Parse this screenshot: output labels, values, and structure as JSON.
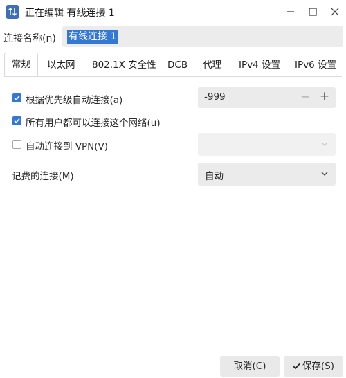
{
  "window": {
    "title": "正在编辑 有线连接 1"
  },
  "name_row": {
    "label": "连接名称(n)",
    "value": "有线连接 1"
  },
  "tabs": [
    {
      "label": "常规"
    },
    {
      "label": "以太网"
    },
    {
      "label": "802.1X 安全性"
    },
    {
      "label": "DCB"
    },
    {
      "label": "代理"
    },
    {
      "label": "IPv4 设置"
    },
    {
      "label": "IPv6 设置"
    }
  ],
  "general": {
    "auto_priority": {
      "label": "根据优先级自动连接(a)",
      "checked": true,
      "value": "-999",
      "minus": "−",
      "plus": "+"
    },
    "all_users": {
      "label": "所有用户都可以连接这个网络(u)",
      "checked": true
    },
    "auto_vpn": {
      "label": "自动连接到 VPN(V)",
      "checked": false,
      "value": ""
    },
    "metered": {
      "label": "记费的连接(M)",
      "value": "自动"
    }
  },
  "buttons": {
    "cancel": "取消(C)",
    "save": "保存(S)"
  }
}
